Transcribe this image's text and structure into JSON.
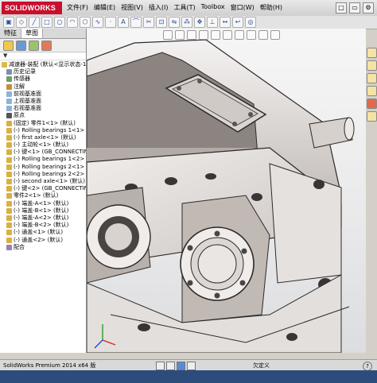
{
  "app": {
    "logo_text": "SOLIDWORKS"
  },
  "menu": [
    "文件(F)",
    "编辑(E)",
    "视图(V)",
    "插入(I)",
    "工具(T)",
    "Toolbox",
    "窗口(W)",
    "帮助(H)"
  ],
  "tabs": [
    "特征",
    "草图"
  ],
  "tree": [
    {
      "label": "减速器-装配 (默认<显示状态-1>)",
      "icon": "assembly-icon"
    },
    {
      "label": "历史记录",
      "icon": "history-icon"
    },
    {
      "label": "传感器",
      "icon": "sensor-icon"
    },
    {
      "label": "注解",
      "icon": "annotation-icon"
    },
    {
      "label": "前视基准面",
      "icon": "plane-icon"
    },
    {
      "label": "上视基准面",
      "icon": "plane-icon"
    },
    {
      "label": "右视基准面",
      "icon": "plane-icon"
    },
    {
      "label": "原点",
      "icon": "origin-icon"
    },
    {
      "label": "(固定) 零件1<1> (默认)",
      "icon": "part-icon"
    },
    {
      "label": "(-) Rolling bearings 1<1>",
      "icon": "part-icon"
    },
    {
      "label": "(-) first axle<1> (默认)",
      "icon": "part-icon"
    },
    {
      "label": "(-) 主动轮<1> (默认)",
      "icon": "part-icon"
    },
    {
      "label": "(-) 键<1> (GB_CONNECTING",
      "icon": "part-icon"
    },
    {
      "label": "(-) Rolling bearings 1<2>",
      "icon": "part-icon"
    },
    {
      "label": "(-) Rolling bearings 2<1>",
      "icon": "part-icon"
    },
    {
      "label": "(-) Rolling bearings 2<2>",
      "icon": "part-icon"
    },
    {
      "label": "(-) second axle<1> (默认)",
      "icon": "part-icon"
    },
    {
      "label": "(-) 键<2> (GB_CONNECTING",
      "icon": "part-icon"
    },
    {
      "label": "零件2<1> (默认)",
      "icon": "part-icon"
    },
    {
      "label": "(-) 端盖-A<1> (默认)",
      "icon": "part-icon"
    },
    {
      "label": "(-) 端盖-B<1> (默认)",
      "icon": "part-icon"
    },
    {
      "label": "(-) 端盖-A<2> (默认)",
      "icon": "part-icon"
    },
    {
      "label": "(-) 端盖-B<2> (默认)",
      "icon": "part-icon"
    },
    {
      "label": "(-) 通盖<1> (默认)",
      "icon": "part-icon"
    },
    {
      "label": "(-) 通盖<2> (默认)",
      "icon": "part-icon"
    },
    {
      "label": "配合",
      "icon": "mate-icon"
    }
  ],
  "status": {
    "app_version": "SolidWorks Premium 2014 x64 版",
    "mode": "欠定义",
    "help": "?"
  },
  "colors": {
    "logo_red": "#c8102e",
    "model_metal": "#e7e4e2",
    "model_shadow": "#8b8480",
    "model_dark": "#3a3535",
    "taskbar_blue": "#2c4c7c"
  }
}
